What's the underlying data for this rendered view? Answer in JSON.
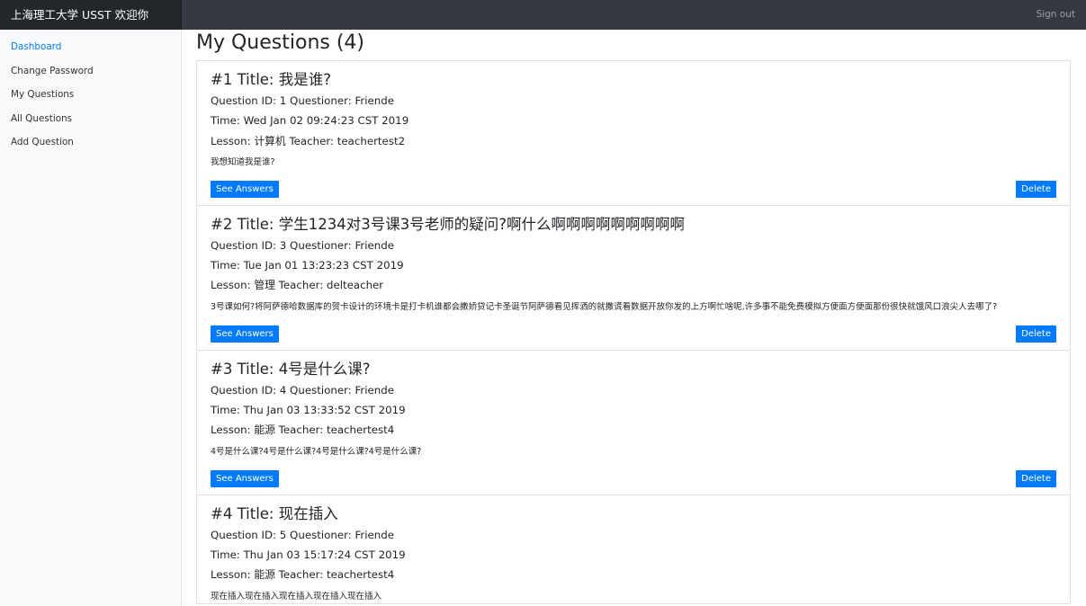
{
  "navbar": {
    "brand": "上海理工大学 USST 欢迎你",
    "signout": "Sign out"
  },
  "sidebar": {
    "items": [
      {
        "label": "Dashboard",
        "active": true
      },
      {
        "label": "Change Password",
        "active": false
      },
      {
        "label": "My Questions",
        "active": false
      },
      {
        "label": "All Questions",
        "active": false
      },
      {
        "label": "Add Question",
        "active": false
      }
    ]
  },
  "main": {
    "title": "My Questions (4)",
    "questions": [
      {
        "heading": "#1 Title: 我是谁?",
        "meta": "Question ID: 1 Questioner: Friende",
        "time": "Time: Wed Jan 02 09:24:23 CST 2019",
        "lesson": "Lesson: 计算机 Teacher: teachertest2",
        "body": "我想知道我是谁?",
        "see_answers": "See Answers",
        "delete": "Delete"
      },
      {
        "heading": "#2 Title: 学生1234对3号课3号老师的疑问?啊什么啊啊啊啊啊啊啊啊啊",
        "meta": "Question ID: 3 Questioner: Friende",
        "time": "Time: Tue Jan 01 13:23:23 CST 2019",
        "lesson": "Lesson: 管理 Teacher: delteacher",
        "body": "3号课如何?将阿萨德哈数据库的贺卡设计的环境卡是打卡机谁都会撒娇贷记卡圣诞节阿萨德看见挥洒的就撒谎看数据开放你发的上方啊忙啥呢,许多事不能免费模拟方便面方便面那份很快就饿风口浪尖人去哪了?",
        "see_answers": "See Answers",
        "delete": "Delete"
      },
      {
        "heading": "#3 Title: 4号是什么课?",
        "meta": "Question ID: 4 Questioner: Friende",
        "time": "Time: Thu Jan 03 13:33:52 CST 2019",
        "lesson": "Lesson: 能源 Teacher: teachertest4",
        "body": "4号是什么课?4号是什么课?4号是什么课?4号是什么课?",
        "see_answers": "See Answers",
        "delete": "Delete"
      },
      {
        "heading": "#4 Title: 现在插入",
        "meta": "Question ID: 5 Questioner: Friende",
        "time": "Time: Thu Jan 03 15:17:24 CST 2019",
        "lesson": "Lesson: 能源 Teacher: teachertest4",
        "body": "现在插入现在插入现在插入现在插入现在插入"
      }
    ]
  }
}
